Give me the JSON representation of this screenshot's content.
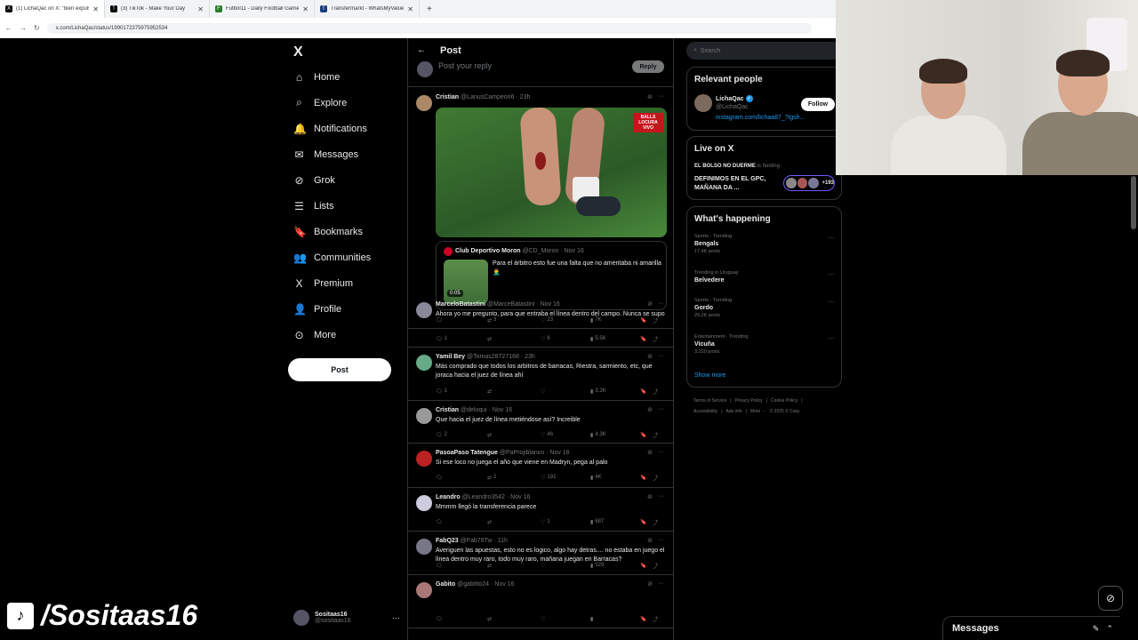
{
  "browser": {
    "tabs": [
      {
        "icon": "X",
        "title": "(1) LichaQac on X: \"bien expuls"
      },
      {
        "icon": "T",
        "title": "(3) TikTok - Make Your Day"
      },
      {
        "icon": "F",
        "title": "Futbol11 - Daily Football Game"
      },
      {
        "icon": "T",
        "title": "Transfermarkt - WhatsMyValue"
      }
    ],
    "new_tab": "+",
    "url": "x.com/LichaQac/status/1990172375975952534"
  },
  "sidebar": {
    "logo": "X",
    "items": [
      {
        "icon": "⌂",
        "label": "Home"
      },
      {
        "icon": "⌕",
        "label": "Explore"
      },
      {
        "icon": "🔔",
        "label": "Notifications"
      },
      {
        "icon": "✉",
        "label": "Messages"
      },
      {
        "icon": "⊘",
        "label": "Grok"
      },
      {
        "icon": "☰",
        "label": "Lists"
      },
      {
        "icon": "🔖",
        "label": "Bookmarks"
      },
      {
        "icon": "👥",
        "label": "Communities"
      },
      {
        "icon": "X",
        "label": "Premium"
      },
      {
        "icon": "👤",
        "label": "Profile"
      },
      {
        "icon": "⊙",
        "label": "More"
      }
    ],
    "post_button": "Post",
    "account": {
      "name": "Sositaas16",
      "handle": "@sositaas16",
      "more": "···"
    }
  },
  "overlay": {
    "text": "/Sositaas16"
  },
  "main": {
    "header": {
      "back": "←",
      "title": "Post"
    },
    "composer": {
      "placeholder": "Post your reply",
      "button": "Reply"
    },
    "first_reply": {
      "name": "Cristian",
      "handle": "@LanusCampeon6",
      "time": "· 23h",
      "media_badge": "BALLS LOCURA VIVO",
      "quote": {
        "name": "Club Deportivo Moron",
        "handle": "@CD_Moron · Nov 16",
        "text": "Para el árbitro esto fue una falta que no ameritaba ni amarilla 🤦‍♂️",
        "duration": "0:05"
      },
      "actions": {
        "comments": "",
        "retweets": "3",
        "likes": "23",
        "views": "7K"
      }
    },
    "replies": [
      {
        "name": "MarceloBatastini",
        "handle": "@MarceBatastini",
        "time": "· Nov 16",
        "text": "Ahora yo me pregunto, para que entraba el línea dentro del campo. Nunca se supo",
        "comments": "1",
        "retweets": "",
        "likes": "6",
        "views": "5.5K"
      },
      {
        "name": "Yamil Bey",
        "handle": "@Tomas28727168",
        "time": "· 23h",
        "text": "Más comprado que todos los arbitros de barracas, Riestra, sarmiento, etc, que joraca hacia el juez de línea ahí",
        "comments": "1",
        "retweets": "",
        "likes": "",
        "views": "3.2K"
      },
      {
        "name": "Cristian",
        "handle": "@deloqui",
        "time": "· Nov 16",
        "text": "Que hacia el juez de línea metiéndose así? Increible",
        "comments": "2",
        "retweets": "",
        "likes": "46",
        "views": "4.3K"
      },
      {
        "name": "PasoaPaso Tatengue",
        "handle": "@PaProjiblanco",
        "time": "· Nov 16",
        "text": "Si ese loco no juega el año que viene en Madryn, pega al palo",
        "comments": "",
        "retweets": "2",
        "likes": "191",
        "views": "4K"
      },
      {
        "name": "Leandro",
        "handle": "@Leandro3542",
        "time": "· Nov 16",
        "text": "Mmmm llegó la transferencia parece",
        "comments": "",
        "retweets": "",
        "likes": "1",
        "views": "887"
      },
      {
        "name": "FabQ23",
        "handle": "@Fab76Tw",
        "time": "· 11h",
        "text": "Averiguen las apuestas, esto no es logico, algo hay detras.... no estaba en juego el línea dentro muy raro, todo muy raro, mañana juegan en Barracas?",
        "comments": "",
        "retweets": "",
        "likes": "",
        "views": "529"
      },
      {
        "name": "Gabito",
        "handle": "@gabitto24",
        "time": "· Nov 16",
        "text": "",
        "comments": "",
        "retweets": "",
        "likes": "",
        "views": ""
      }
    ]
  },
  "right": {
    "search_placeholder": "Search",
    "relevant": {
      "title": "Relevant people",
      "name": "LichaQac",
      "handle": "@LichaQac",
      "bio": "instagram.com/lichaa87_?igsh...",
      "follow": "Follow"
    },
    "live": {
      "title": "Live on X",
      "host": "EL BOLSO NO DUERME",
      "host_suffix": " is hosting",
      "title_text": "DEFINIMOS EN EL GPC, MAÑANA DA ...",
      "count": "+193"
    },
    "happening": {
      "title": "What's happening",
      "trends": [
        {
          "category": "Sports · Trending",
          "name": "Bengals",
          "posts": "17.4K posts"
        },
        {
          "category": "Trending in Uruguay",
          "name": "Belvedere",
          "posts": ""
        },
        {
          "category": "Sports · Trending",
          "name": "Gordo",
          "posts": "29.2K posts"
        },
        {
          "category": "Entertainment · Trending",
          "name": "Vicuña",
          "posts": "3,220 posts"
        }
      ],
      "show_more": "Show more"
    },
    "footer": [
      "Terms of Service",
      "|",
      "Privacy Policy",
      "|",
      "Cookie Policy",
      "|",
      "Accessibility",
      "|",
      "Ads info",
      "|",
      "More ···",
      "© 2025 X Corp."
    ]
  },
  "messages_drawer": {
    "title": "Messages"
  }
}
